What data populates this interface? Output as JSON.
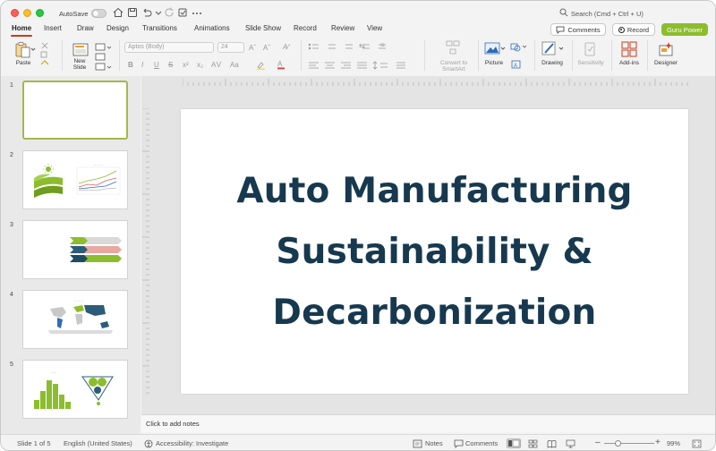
{
  "titlebar": {
    "autosave_label": "AutoSave",
    "search_label": "Search (Cmd + Ctrl + U)"
  },
  "tabs": [
    {
      "label": "Home",
      "active": true
    },
    {
      "label": "Insert"
    },
    {
      "label": "Draw"
    },
    {
      "label": "Design"
    },
    {
      "label": "Transitions"
    },
    {
      "label": "Animations"
    },
    {
      "label": "Slide Show"
    },
    {
      "label": "Record"
    },
    {
      "label": "Review"
    },
    {
      "label": "View"
    }
  ],
  "header_buttons": {
    "comments": "Comments",
    "record": "Record",
    "guru": "Guru Power"
  },
  "ribbon": {
    "paste": "Paste",
    "new_slide_line1": "New",
    "new_slide_line2": "Slide",
    "font_name": "Aptos (Body)",
    "font_size": "24",
    "convert_line1": "Convert to",
    "convert_line2": "SmartArt",
    "picture": "Picture",
    "drawing": "Drawing",
    "sensitivity": "Sensitivity",
    "addins": "Add-ins",
    "designer": "Designer"
  },
  "slides": [
    {
      "number": "1"
    },
    {
      "number": "2"
    },
    {
      "number": "3"
    },
    {
      "number": "4"
    },
    {
      "number": "5"
    }
  ],
  "slide_title": {
    "line1": "Auto Manufacturing",
    "line2": "Sustainability &",
    "line3": "Decarbonization"
  },
  "notes_placeholder": "Click to add notes",
  "status": {
    "slide_count": "Slide 1 of 5",
    "language": "English (United States)",
    "accessibility": "Accessibility: Investigate",
    "notes": "Notes",
    "comments": "Comments",
    "zoom": "99%"
  },
  "colors": {
    "title_text": "#17394f",
    "accent_green": "#8cbd2d",
    "tab_underline": "#c43e1c"
  }
}
